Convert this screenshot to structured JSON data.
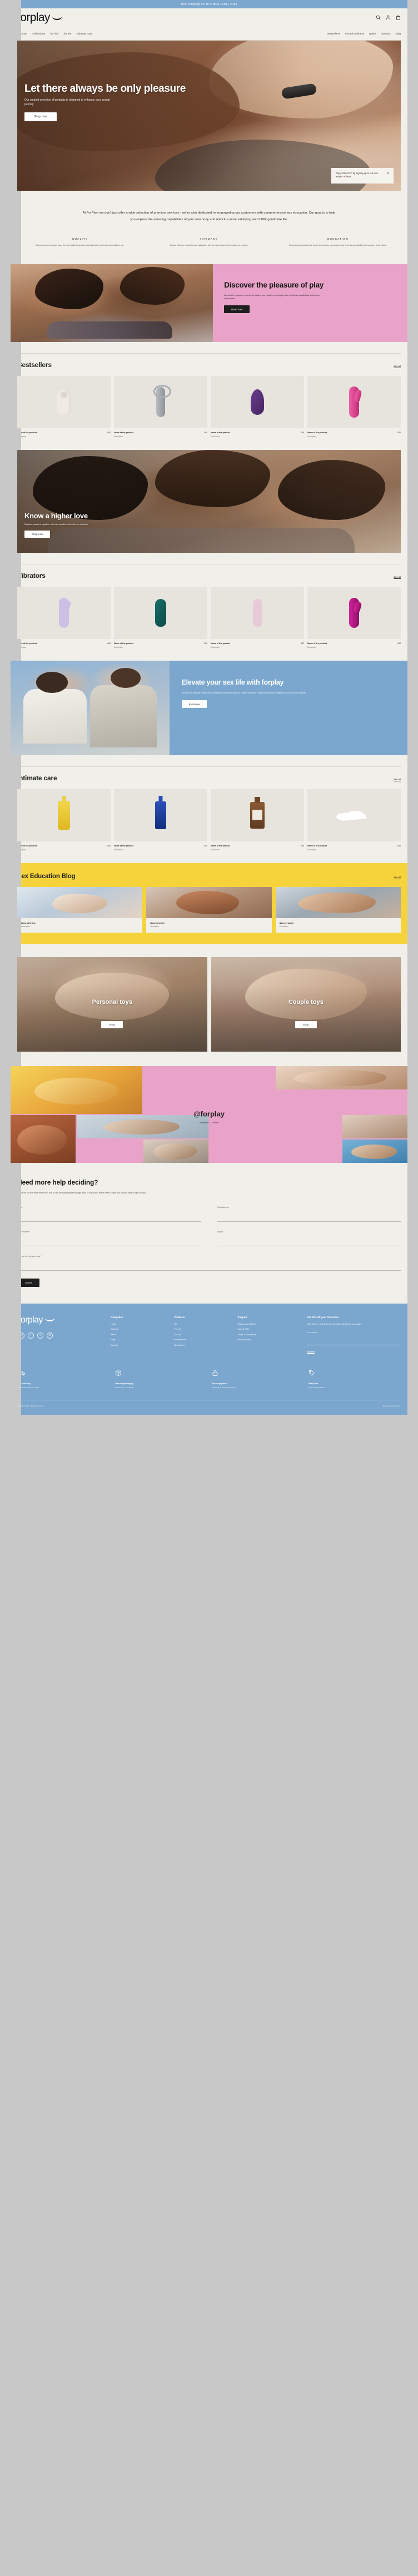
{
  "announcement": "free shipping on all orders 125$+ (UK)",
  "brand": {
    "name": "forplay"
  },
  "header": {
    "icons": {
      "search": "search-icon",
      "account": "user-icon",
      "cart": "bag-icon"
    },
    "nav_left": [
      "discover",
      "collections",
      "for him",
      "for her",
      "intimate care"
    ],
    "nav_right": [
      "bestsellers",
      "sexual wellness",
      "guide",
      "rewards",
      "blog"
    ]
  },
  "hero": {
    "title": "Let there always be only pleasure",
    "subtitle": "Our curated selection of products is designed to enhance your sexual journey",
    "cta": "Shop now",
    "promo": {
      "text": "Enjoy 10% OFF by signing up to our love letters 💌 here.",
      "close": "×"
    }
  },
  "mission": {
    "paragraph": "At ForPlay, we don't just offer a wide selection of premium sex toys - we're also dedicated to empowering our customers with comprehensive sex education. Our goal is to help you explore the amazing capabilities of your own body and unlock a more satisfying and fulfilling intimate life.",
    "values": [
      {
        "title": "QUALITY",
        "text": "All products are designed using the high quality, body-safe materials that are safe and comfortable to use."
      },
      {
        "title": "INTIMACY",
        "text": "Explore intimacy, connection and satisfaction with the most advanced technology we produce."
      },
      {
        "title": "EDUCATION",
        "text": "Empowering exploration for singles and couples, opening the door to the best possibilities and answers to the basics."
      }
    ]
  },
  "pink_banner": {
    "title": "Discover the pleasure of play",
    "text": "We want to empower everyone for singles and couples, opening the door to intimate possibilities and deeper connections.",
    "cta": "Read now"
  },
  "bestsellers": {
    "title": "Bestsellers",
    "see_all": "See all",
    "products": [
      {
        "name": "Name of the product",
        "desc": "Description",
        "price": "£00",
        "shape": "s-suction"
      },
      {
        "name": "Name of the product",
        "desc": "Description",
        "price": "£00",
        "shape": "s-wand"
      },
      {
        "name": "Name of the product",
        "desc": "Description",
        "price": "£00",
        "shape": "s-egg"
      },
      {
        "name": "Name of the product",
        "desc": "Description",
        "price": "£00",
        "shape": "s-rabbit"
      }
    ]
  },
  "mid_banner": {
    "title": "Know a higher love",
    "text": "Explore pleasure together with our curated collection for couples.",
    "cta": "Shop now"
  },
  "vibrators": {
    "title": "Vibrators",
    "see_all": "See all",
    "products": [
      {
        "name": "Name of the product",
        "desc": "Description",
        "price": "£00",
        "shape": "s-lilac"
      },
      {
        "name": "Name of the product",
        "desc": "Description",
        "price": "£00",
        "shape": "s-teal"
      },
      {
        "name": "Name of the product",
        "desc": "Description",
        "price": "£00",
        "shape": "s-pinkpale"
      },
      {
        "name": "Name of the product",
        "desc": "Description",
        "price": "£00",
        "shape": "s-magenta"
      }
    ]
  },
  "blue_cta": {
    "title": "Elevate your sex life with forplay",
    "text": "Discover the ultimate expression of pleasure and intimacy with our curated collection of premium products designed for you and your partner.",
    "cta": "Read now"
  },
  "intimate_care": {
    "title": "Intimate care",
    "see_all": "See all",
    "products": [
      {
        "name": "Name of the product",
        "desc": "Description",
        "price": "£00",
        "shape": "s-bottle-y"
      },
      {
        "name": "Name of the product",
        "desc": "Description",
        "price": "£00",
        "shape": "s-bottle-b"
      },
      {
        "name": "Name of the product",
        "desc": "Description",
        "price": "£00",
        "shape": "s-bottle-a"
      },
      {
        "name": "Name of the product",
        "desc": "Description",
        "price": "£00",
        "shape": "s-wavy"
      }
    ]
  },
  "blog": {
    "title": "Sex Education Blog",
    "see_all": "See all",
    "articles": [
      {
        "name": "Name of article",
        "desc": "Description",
        "thumb": "bt1"
      },
      {
        "name": "Name of article",
        "desc": "Description",
        "thumb": "bt2"
      },
      {
        "name": "Name of article",
        "desc": "Description",
        "thumb": "bt3"
      }
    ]
  },
  "tiles": [
    {
      "title": "Personal toys",
      "cta": "Shop"
    },
    {
      "title": "Couple toys",
      "cta": "Shop"
    }
  ],
  "instagram": {
    "handle": "@forplay",
    "sub": "instagram",
    "sub2": "TikTok"
  },
  "contact": {
    "title": "Need more help deciding?",
    "text": "Simply fill out the form below and one of our intimacy experts will get back to you soon. We're here to help you choose what's right for you.",
    "fields": {
      "name_label": "Name",
      "name_value": "",
      "email_label": "Email address",
      "email_value": "",
      "phone_label": "Phone number",
      "phone_value": "",
      "subject_label": "Subject",
      "subject_value": "",
      "message_label": "How can we help you today?",
      "message_value": ""
    },
    "submit": "Submit"
  },
  "footer": {
    "socials": [
      "instagram-icon",
      "facebook-icon",
      "tiktok-icon",
      "pinterest-icon"
    ],
    "columns": [
      {
        "heading": "Navigation",
        "links": [
          "Home",
          "Shop all",
          "About",
          "Blog",
          "Contact"
        ]
      },
      {
        "heading": "Products",
        "links": [
          "All",
          "For him",
          "For her",
          "Intimate care",
          "Bestsellers"
        ]
      },
      {
        "heading": "Support",
        "links": [
          "Shipping & Returns",
          "Help & FAQ",
          "Terms & Conditions",
          "Privacy Policy"
        ]
      }
    ],
    "newsletter": {
      "heading": "Get 10% off your first order",
      "text": "Save 25% on your first order by joining the forplay community.",
      "email_label": "Email address*",
      "email_value": "",
      "submit": "Submit"
    },
    "features": [
      {
        "icon": "truck-icon",
        "title": "Free delivery",
        "text": "On all UK orders over £125"
      },
      {
        "icon": "package-icon",
        "title": "Discreet packaging",
        "text": "Plain boxes, no branding"
      },
      {
        "icon": "lock-icon",
        "title": "Secure payment",
        "text": "100% safe & encrypted checkout"
      },
      {
        "icon": "tag-icon",
        "title": "Best price",
        "text": "Price match guarantee"
      }
    ],
    "copyright": "© 2024 forplay. All rights reserved.",
    "credits": "Design & development"
  }
}
